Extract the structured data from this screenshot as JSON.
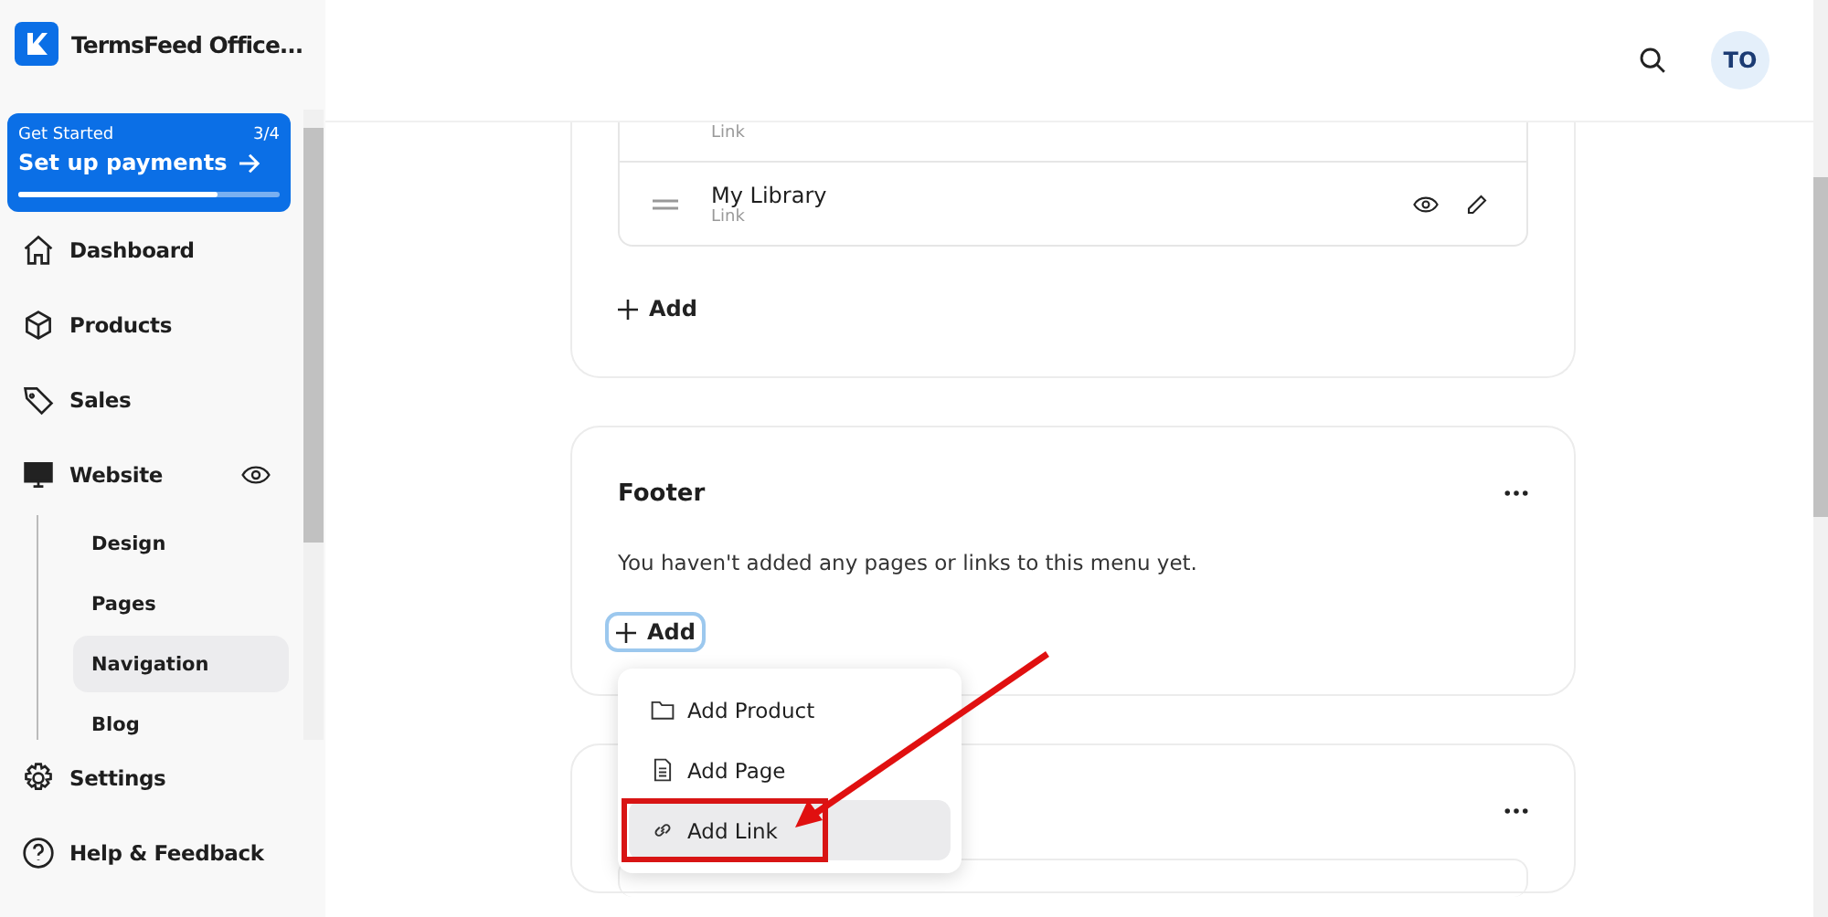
{
  "app": {
    "title": "TermsFeed Office..."
  },
  "onboarding": {
    "label": "Get Started",
    "step": "3/4",
    "action": "Set up payments",
    "level": 0.76
  },
  "nav": [
    {
      "label": "Dashboard",
      "kind": "home",
      "selected": false
    },
    {
      "label": "Products",
      "kind": "box",
      "selected": false
    },
    {
      "label": "Sales",
      "kind": "tag",
      "selected": false
    },
    {
      "label": "Website",
      "kind": "monitor",
      "selected": false,
      "children": [
        {
          "label": "Design",
          "selected": false
        },
        {
          "label": "Pages",
          "selected": false
        },
        {
          "label": "Navigation",
          "selected": true
        },
        {
          "label": "Blog",
          "selected": false
        }
      ]
    }
  ],
  "nav_bottom": [
    {
      "label": "Settings",
      "kind": "gear"
    },
    {
      "label": "Help & Feedback",
      "kind": "help"
    }
  ],
  "header": {
    "avatar": "TO"
  },
  "menus": [
    {
      "items": [
        {
          "subtitle": "Link"
        },
        {
          "title": "My Library",
          "subtitle": "Link"
        }
      ],
      "add": "Add",
      "focused": false
    },
    {
      "title": "Footer",
      "empty": "You haven't added any pages or links to this menu yet.",
      "add": "Add",
      "focused": true,
      "dropdown": [
        {
          "label": "Add Product",
          "kind": "folder",
          "selected": false
        },
        {
          "label": "Add Page",
          "kind": "page",
          "selected": false
        },
        {
          "label": "Add Link",
          "kind": "link",
          "selected": true
        }
      ]
    },
    {
      "partial": true
    }
  ]
}
